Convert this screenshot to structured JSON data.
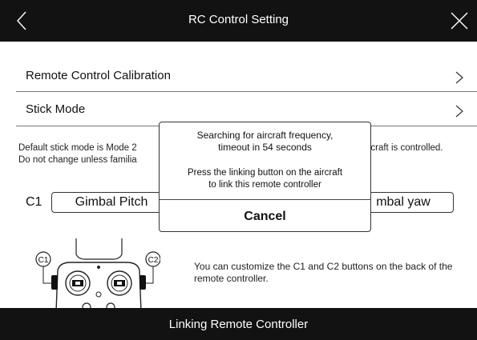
{
  "header": {
    "title": "RC Control Setting"
  },
  "rows": {
    "calibration": "Remote Control Calibration",
    "stick_mode": "Stick Mode"
  },
  "description": {
    "line1_left": "Default stick mode is Mode 2",
    "line1_right": "ircraft is controlled.",
    "line2_left": "Do not change unless familia"
  },
  "custom_buttons": {
    "c1_label": "C1",
    "c1_value": "Gimbal Pitch",
    "c2_value": "mbal yaw",
    "figure_c1": "C1",
    "figure_c2": "C2",
    "hint": "You can customize the C1 and C2 buttons on the back of the remote controller."
  },
  "dialog": {
    "message": "Searching for aircraft frequency, timeout in 54 seconds",
    "message_line1": "Searching for aircraft frequency,",
    "message_line2": "timeout in 54 seconds",
    "instruction_line1": "Press the linking button on the aircraft",
    "instruction_line2": "to link this remote controller",
    "cancel_label": "Cancel"
  },
  "footer": {
    "label": "Linking Remote Controller"
  },
  "colors": {
    "bar": "#121212",
    "text": "#111111",
    "background": "#ffffff"
  },
  "icons": [
    "back-chevron-icon",
    "close-icon",
    "chevron-right-icon",
    "remote-controller-icon"
  ]
}
